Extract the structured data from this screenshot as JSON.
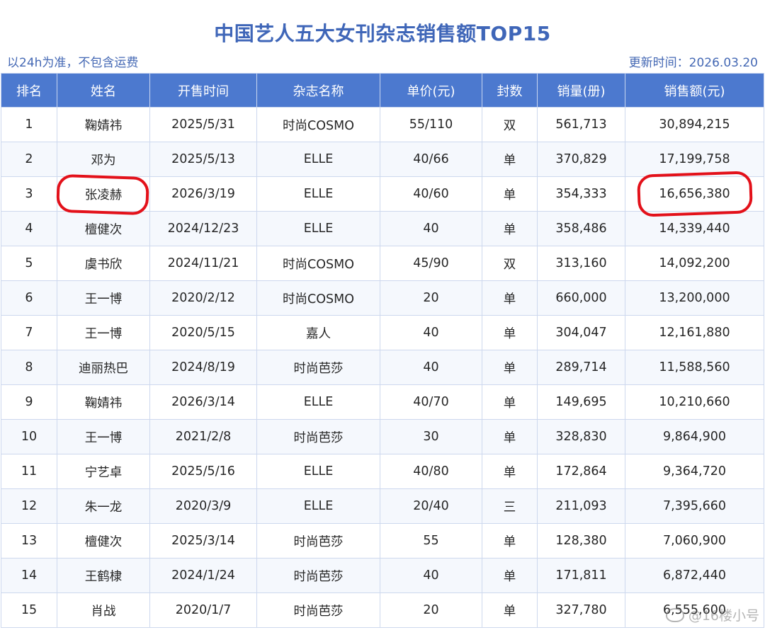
{
  "title": "中国艺人五大女刊杂志销售额TOP15",
  "note": "以24h为准，不包含运费",
  "updated": "更新时间：2026.03.20",
  "colors": {
    "header_bg": "#4c79cf",
    "title": "#3f66b8",
    "highlight_circle": "#e3111a"
  },
  "table": {
    "headers": [
      "排名",
      "姓名",
      "开售时间",
      "杂志名称",
      "单价(元)",
      "封数",
      "销量(册)",
      "销售额(元)"
    ],
    "rows": [
      [
        "1",
        "鞠婧祎",
        "2025/5/31",
        "时尚COSMO",
        "55/110",
        "双",
        "561,713",
        "30,894,215"
      ],
      [
        "2",
        "邓为",
        "2025/5/13",
        "ELLE",
        "40/66",
        "单",
        "370,829",
        "17,199,758"
      ],
      [
        "3",
        "张凌赫",
        "2026/3/19",
        "ELLE",
        "40/60",
        "单",
        "354,333",
        "16,656,380"
      ],
      [
        "4",
        "檀健次",
        "2024/12/23",
        "ELLE",
        "40",
        "单",
        "358,486",
        "14,339,440"
      ],
      [
        "5",
        "虞书欣",
        "2024/11/21",
        "时尚COSMO",
        "45/90",
        "双",
        "313,160",
        "14,092,200"
      ],
      [
        "6",
        "王一博",
        "2020/2/12",
        "时尚COSMO",
        "20",
        "单",
        "660,000",
        "13,200,000"
      ],
      [
        "7",
        "王一博",
        "2020/5/15",
        "嘉人",
        "40",
        "单",
        "304,047",
        "12,161,880"
      ],
      [
        "8",
        "迪丽热巴",
        "2024/8/19",
        "时尚芭莎",
        "40",
        "单",
        "289,714",
        "11,588,560"
      ],
      [
        "9",
        "鞠婧祎",
        "2026/3/14",
        "ELLE",
        "40/70",
        "单",
        "149,695",
        "10,210,660"
      ],
      [
        "10",
        "王一博",
        "2021/2/8",
        "时尚芭莎",
        "30",
        "单",
        "328,830",
        "9,864,900"
      ],
      [
        "11",
        "宁艺卓",
        "2025/5/16",
        "ELLE",
        "40/80",
        "单",
        "172,864",
        "9,364,720"
      ],
      [
        "12",
        "朱一龙",
        "2020/3/9",
        "ELLE",
        "20/40",
        "三",
        "211,093",
        "7,395,660"
      ],
      [
        "13",
        "檀健次",
        "2025/3/14",
        "时尚芭莎",
        "55",
        "单",
        "128,380",
        "7,060,900"
      ],
      [
        "14",
        "王鹤棣",
        "2024/1/24",
        "时尚芭莎",
        "40",
        "单",
        "171,811",
        "6,872,440"
      ],
      [
        "15",
        "肖战",
        "2020/1/7",
        "时尚芭莎",
        "20",
        "单",
        "327,780",
        "6,555,600"
      ]
    ]
  },
  "watermark": {
    "icon": "weibo-icon",
    "text": "@16楼小号"
  }
}
